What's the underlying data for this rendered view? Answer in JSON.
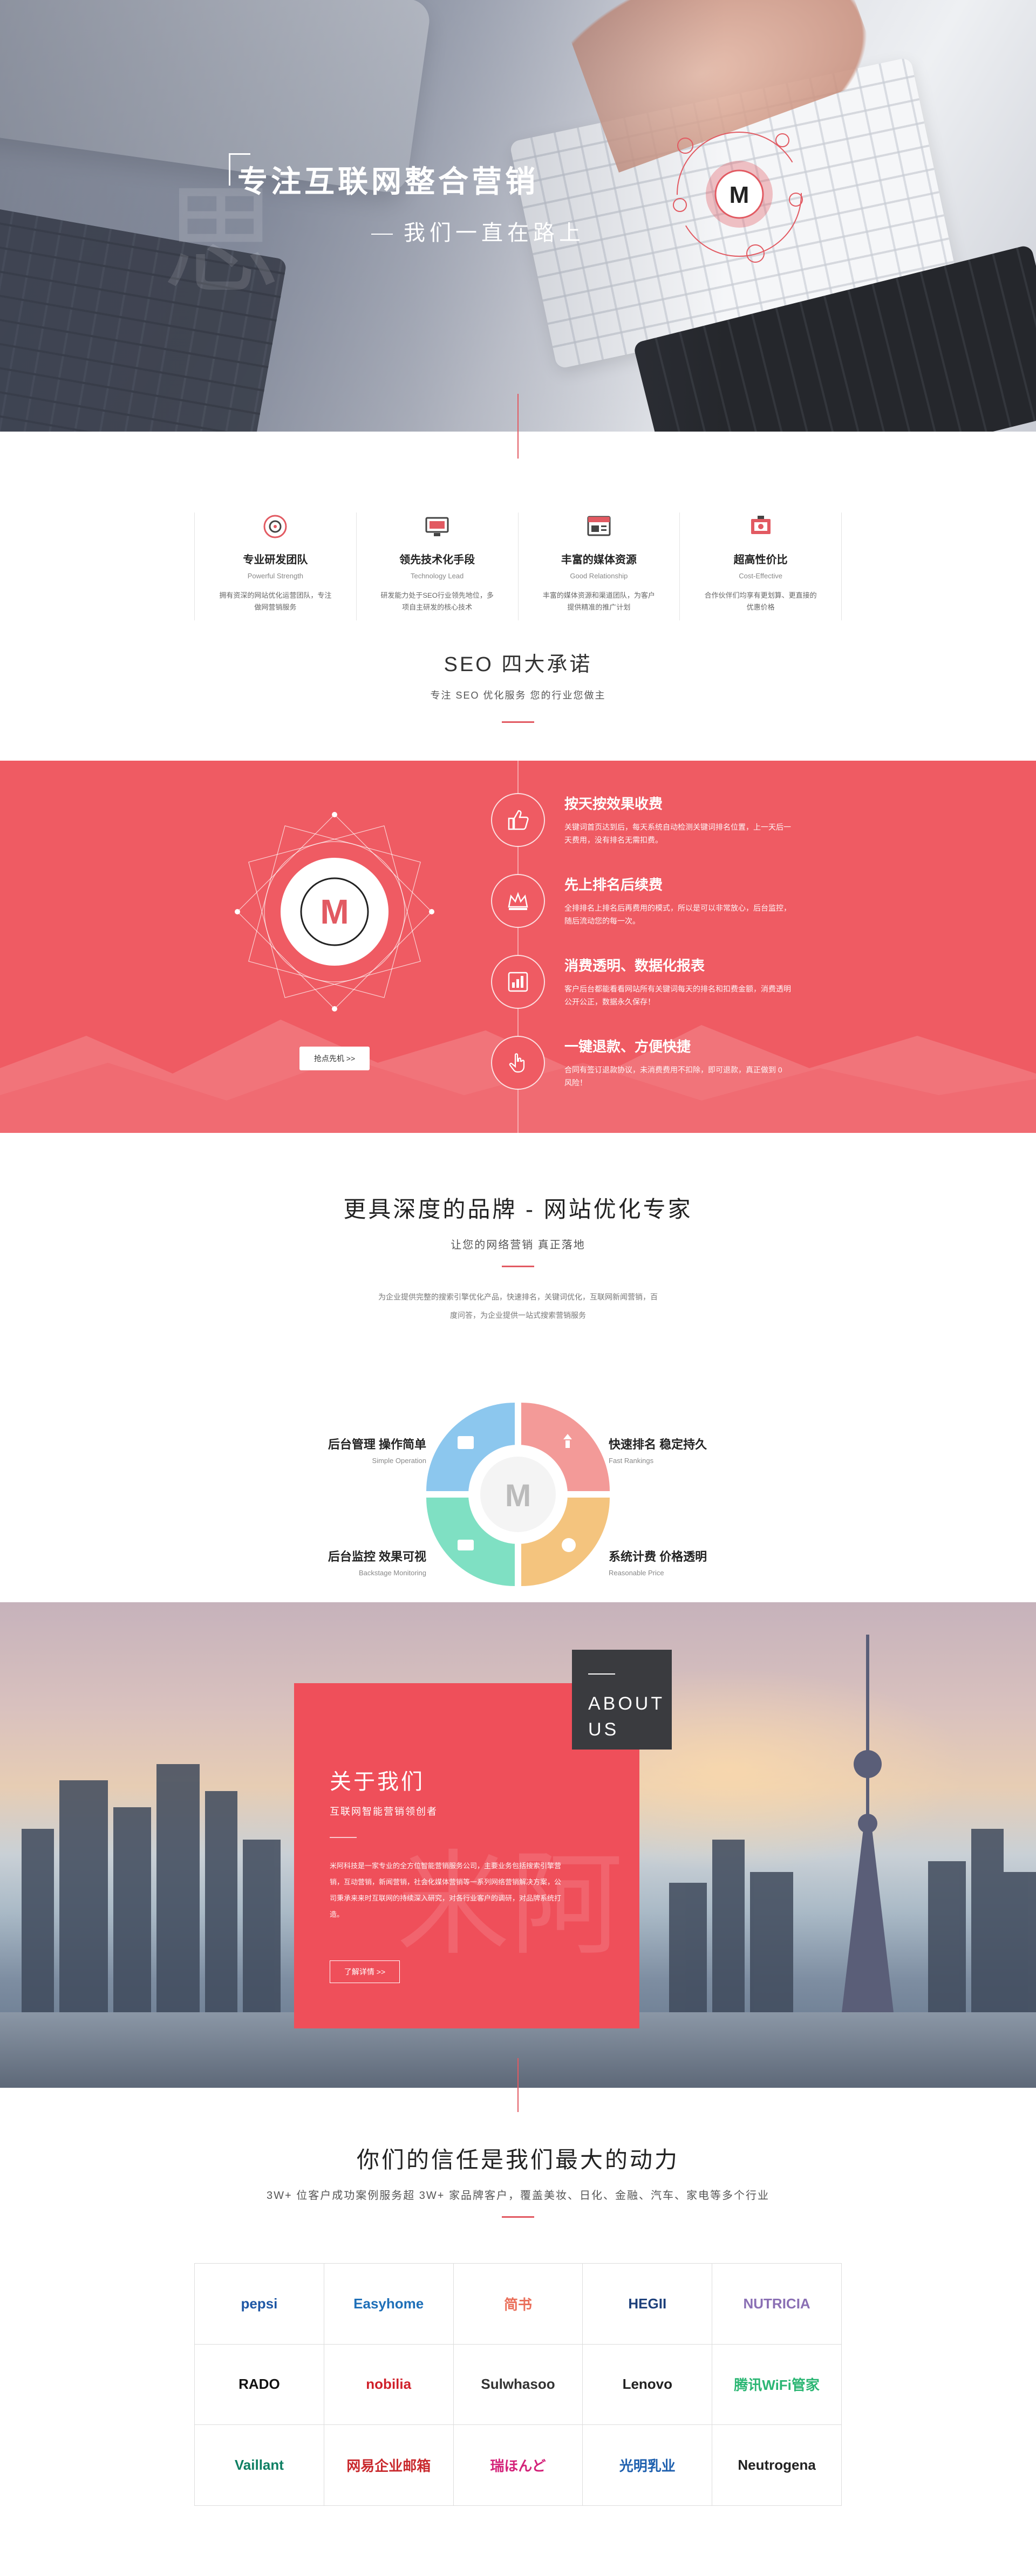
{
  "hero": {
    "title": "专注互联网整合营销",
    "subtitle": "我们一直在路上",
    "ghost_char": "思",
    "logo_mark": "M"
  },
  "features": [
    {
      "title": "专业研发团队",
      "en": "Powerful Strength",
      "desc": "拥有资深的网站优化运营团队，专注做网营销服务",
      "icon": "target-icon"
    },
    {
      "title": "领先技术化手段",
      "en": "Technology Lead",
      "desc": "研发能力处于SEO行业领先地位，多项自主研发的核心技术",
      "icon": "computer-icon"
    },
    {
      "title": "丰富的媒体资源",
      "en": "Good Relationship",
      "desc": "丰富的媒体资源和渠道团队，为客户提供精准的推广计划",
      "icon": "media-icon"
    },
    {
      "title": "超高性价比",
      "en": "Cost-Effective",
      "desc": "合作伙伴们均享有更划算、更直接的优惠价格",
      "icon": "price-tag-icon"
    }
  ],
  "seo_head": {
    "title": "SEO 四大承诺",
    "subtitle": "专注 SEO 优化服务 您的行业您做主"
  },
  "seo_band": {
    "more_button": "抢点先机 >>",
    "items": [
      {
        "title": "按天按效果收费",
        "desc": "关键词首页达到后，每天系统自动检测关键词排名位置，上一天后一天费用，没有排名无需扣费。",
        "icon": "thumbs-up-icon"
      },
      {
        "title": "先上排名后续费",
        "desc": "全排排名上排名后再费用的模式，所以是可以非常放心，后台监控，随后流动您的每一次。",
        "icon": "crown-icon"
      },
      {
        "title": "消费透明、数据化报表",
        "desc": "客户后台都能看看网站所有关键词每天的排名和扣费金额，消费透明公开公正，数据永久保存！",
        "icon": "bar-chart-icon"
      },
      {
        "title": "一键退款、方便快捷",
        "desc": "合同有签订退款协议，未消费费用不扣除，即可退款，真正做到 0 风险！",
        "icon": "hand-pointer-icon"
      }
    ]
  },
  "brand": {
    "title": "更具深度的品牌 - 网站优化专家",
    "subtitle": "让您的网络营销 真正落地",
    "desc": "为企业提供完整的搜索引擎优化产品，快速排名，关键词优化，互联网新闻营销，百度问答，为企业提供一站式搜索营销服务",
    "labels": [
      {
        "title": "后台管理 操作简单",
        "en": "Simple Operation"
      },
      {
        "title": "快速排名 稳定持久",
        "en": "Fast Rankings"
      },
      {
        "title": "后台监控 效果可视",
        "en": "Backstage Monitoring"
      },
      {
        "title": "系统计费 价格透明",
        "en": "Reasonable Price"
      }
    ],
    "colors": {
      "tl": "#8cc7ee",
      "tr": "#f39a98",
      "bl": "#7fe0c3",
      "br": "#f4c47e"
    }
  },
  "about": {
    "tag": "ABOUT US",
    "tag_line1": "ABOUT",
    "tag_line2": "US",
    "title": "关于我们",
    "subtitle": "互联网智能营销领创者",
    "desc": "米阿科技是一家专业的全方位智能营销服务公司，主要业务包括搜索引擎营销，互动营销，新闻营销，社会化媒体营销等一系列网络营销解决方案，公司秉承来来时互联网的持续深入研究，对各行业客户的调研，对品牌系统打造。",
    "button": "了解详情 >>",
    "ghost_char": "米阿"
  },
  "trust": {
    "title": "你们的信任是我们最大的动力",
    "subtitle": "3W+ 位客户成功案例服务超 3W+ 家品牌客户，覆盖美妆、日化、金融、汽车、家电等多个行业",
    "logos": [
      {
        "name": "pepsi",
        "color": "#1e57a5"
      },
      {
        "name": "Easyhome",
        "color": "#1e6fb8"
      },
      {
        "name": "简书",
        "color": "#ea6f5a"
      },
      {
        "name": "HEGII",
        "color": "#1c3f7a"
      },
      {
        "name": "NUTRICIA",
        "color": "#8a6fb4"
      },
      {
        "name": "RADO",
        "color": "#111111"
      },
      {
        "name": "nobilia",
        "color": "#d0202a"
      },
      {
        "name": "Sulwhasoo",
        "color": "#333333"
      },
      {
        "name": "Lenovo",
        "color": "#222222"
      },
      {
        "name": "腾讯WiFi管家",
        "color": "#2bb673"
      },
      {
        "name": "Vaillant",
        "color": "#0e7f63"
      },
      {
        "name": "网易企业邮箱",
        "color": "#c9292d"
      },
      {
        "name": "瑞ほんど",
        "color": "#d4237a"
      },
      {
        "name": "光明乳业",
        "color": "#1d5fae"
      },
      {
        "name": "Neutrogena",
        "color": "#222222"
      }
    ]
  }
}
